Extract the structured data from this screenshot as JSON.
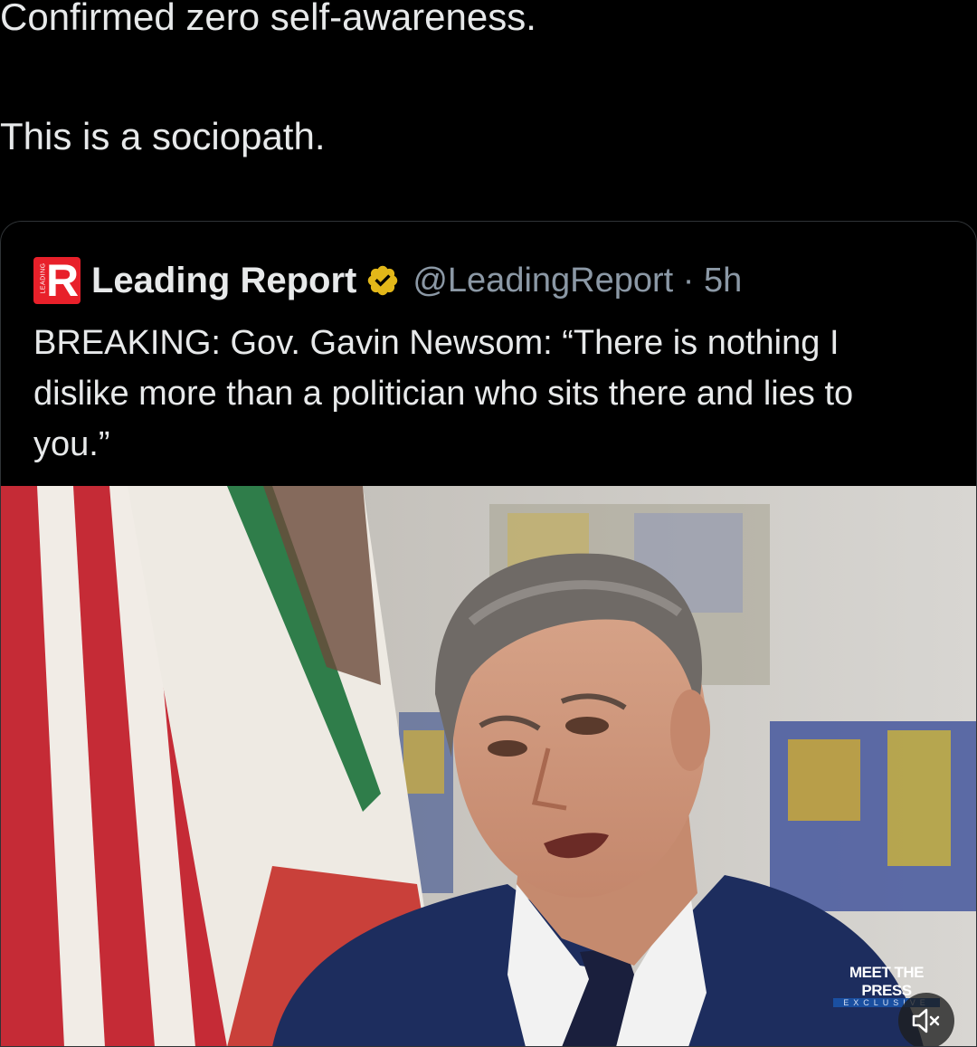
{
  "post": {
    "line1": "Confirmed zero self-awareness.",
    "line2": "This is a sociopath."
  },
  "quoted_tweet": {
    "avatar_letter": "R",
    "avatar_vertical_text": "LEADING",
    "author_name": "Leading Report",
    "handle_time": "@LeadingReport · 5h",
    "body": "BREAKING: Gov. Gavin Newsom: “There is nothing I dislike more than a politician who sits there and lies to you.”",
    "media": {
      "watermark_title": "MEET THE PRESS",
      "watermark_sub": "EXCLUSIVE",
      "mute_icon": "speaker-muted-icon"
    }
  },
  "colors": {
    "background": "#000000",
    "text": "#e7e9ea",
    "secondary_text": "#8b98a5",
    "border": "#2f3336",
    "verified_badge": "#e2b719",
    "avatar_red": "#e8202a"
  }
}
